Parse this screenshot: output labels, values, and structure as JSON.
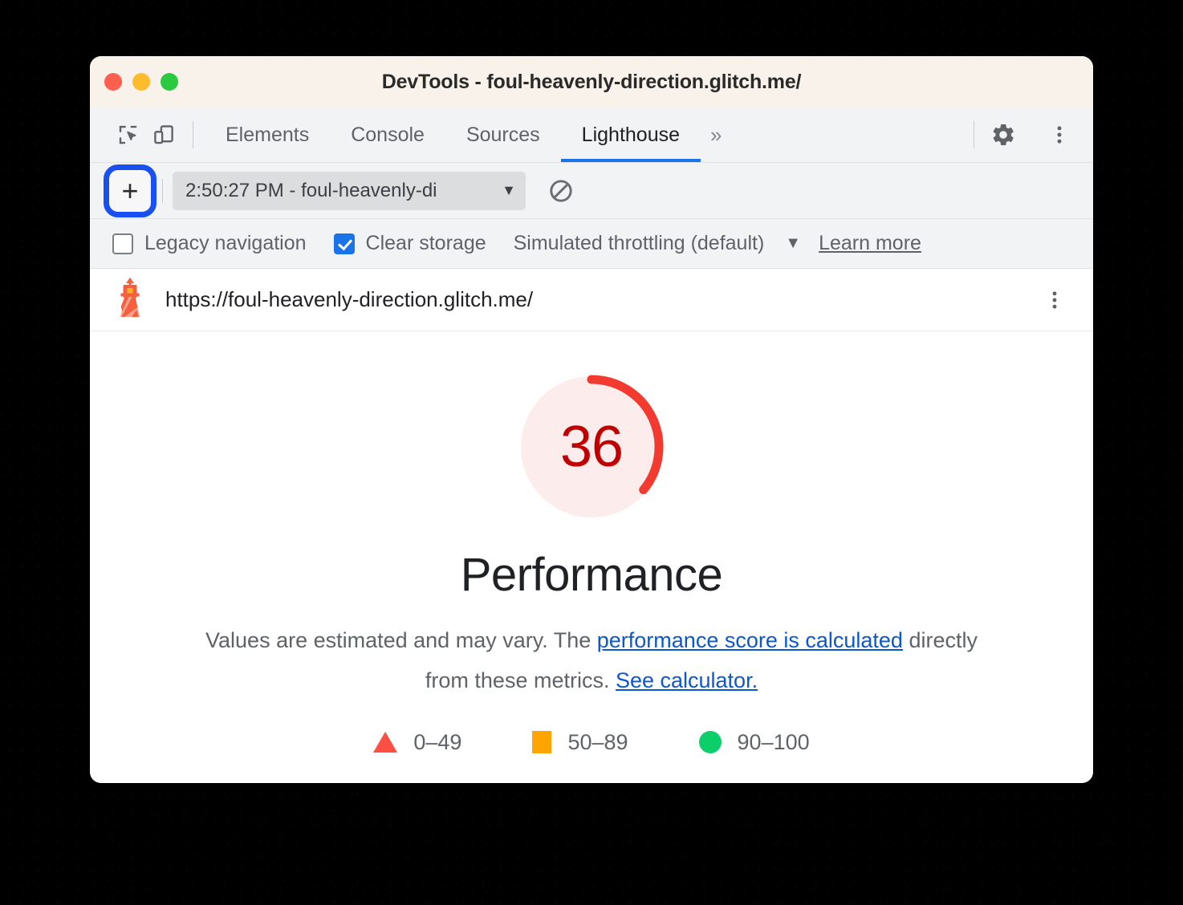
{
  "window": {
    "title": "DevTools - foul-heavenly-direction.glitch.me/",
    "traffic_lights": [
      "close",
      "minimize",
      "maximize"
    ]
  },
  "devtools": {
    "left_icons": [
      {
        "name": "inspect-element-icon",
        "label": "Inspect element"
      },
      {
        "name": "device-toolbar-icon",
        "label": "Toggle device toolbar"
      }
    ],
    "tabs": [
      {
        "label": "Elements",
        "selected": false
      },
      {
        "label": "Console",
        "selected": false
      },
      {
        "label": "Sources",
        "selected": false
      },
      {
        "label": "Lighthouse",
        "selected": true
      }
    ],
    "more_tabs_label": "»",
    "right_icons": [
      {
        "name": "settings-gear-icon",
        "label": "Settings"
      },
      {
        "name": "more-options-kebab-icon",
        "label": "Customize and control DevTools"
      }
    ]
  },
  "lighthouse_toolbar": {
    "add_button_label": "+",
    "add_button_highlighted": true,
    "highlight_color": "#1a4ff0",
    "report_select_value": "2:50:27 PM - foul-heavenly-di",
    "report_select_caret": "▼",
    "clear_all_label": "Clear all"
  },
  "options": {
    "legacy_navigation": {
      "label": "Legacy navigation",
      "checked": false
    },
    "clear_storage": {
      "label": "Clear storage",
      "checked": true
    },
    "throttling": {
      "label": "Simulated throttling (default)",
      "caret": "▼"
    },
    "learn_more": {
      "label": "Learn more"
    }
  },
  "report": {
    "site_icon": "lighthouse-icon",
    "url": "https://foul-heavenly-direction.glitch.me/",
    "kebab_label": "Report options",
    "category": "Performance",
    "description_prefix": "Values are estimated and may vary. The ",
    "description_link_1": "performance score is calculated",
    "description_middle": " directly from these metrics. ",
    "description_link_2": "See calculator."
  },
  "chart_data": {
    "type": "gauge",
    "title": "Performance",
    "value": 36,
    "min": 0,
    "max": 100,
    "unit": "score",
    "rating": "fail",
    "arc_color": "#f33a30",
    "track_color": "#fcecec",
    "value_color": "#c00000",
    "start_angle_deg": 0,
    "sweep_deg": 129.6,
    "legend": [
      {
        "label": "0–49",
        "shape": "triangle",
        "color": "#ff4e42",
        "range": [
          0,
          49
        ]
      },
      {
        "label": "50–89",
        "shape": "square",
        "color": "#ffa400",
        "range": [
          50,
          89
        ]
      },
      {
        "label": "90–100",
        "shape": "circle",
        "color": "#0cce6b",
        "range": [
          90,
          100
        ]
      }
    ]
  }
}
